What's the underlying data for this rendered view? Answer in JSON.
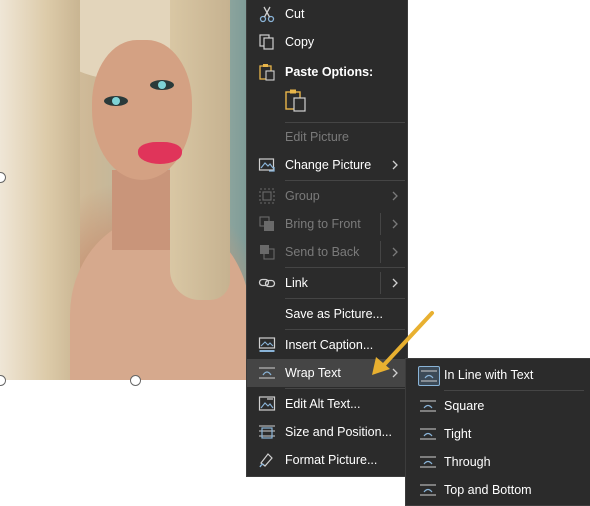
{
  "menu": {
    "cut": "Cut",
    "copy": "Copy",
    "paste_options": "Paste Options:",
    "edit_picture": "Edit Picture",
    "change_picture": "Change Picture",
    "group": "Group",
    "bring_to_front": "Bring to Front",
    "send_to_back": "Send to Back",
    "link": "Link",
    "save_as_picture": "Save as Picture...",
    "insert_caption": "Insert Caption...",
    "wrap_text": "Wrap Text",
    "edit_alt_text": "Edit Alt Text...",
    "size_and_position": "Size and Position...",
    "format_picture": "Format Picture..."
  },
  "wrap_submenu": {
    "in_line_with_text": "In Line with Text",
    "square": "Square",
    "tight": "Tight",
    "through": "Through",
    "top_and_bottom": "Top and Bottom"
  },
  "colors": {
    "menu_bg": "#2b2b2b",
    "highlight": "#454545",
    "disabled_text": "#7a7a7a",
    "icon_accent": "#8ab4d8",
    "paste_accent": "#e8b54a",
    "annotation_arrow": "#e8b030"
  },
  "icons": [
    "scissors-icon",
    "copy-icon",
    "paste-icon",
    "paste-keep-format-icon",
    "change-picture-icon",
    "group-icon",
    "bring-to-front-icon",
    "send-to-back-icon",
    "link-icon",
    "insert-caption-icon",
    "wrap-text-icon",
    "alt-text-icon",
    "size-position-icon",
    "format-picture-icon",
    "chevron-right-icon"
  ]
}
